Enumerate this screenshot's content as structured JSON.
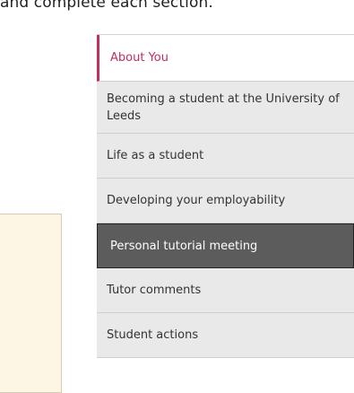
{
  "intro": {
    "text": "and complete each section."
  },
  "nav": {
    "items": [
      {
        "label": "About You"
      },
      {
        "label": "Becoming a student at the University of Leeds"
      },
      {
        "label": "Life as a student"
      },
      {
        "label": "Developing your employability"
      },
      {
        "label": "Personal tutorial meeting"
      },
      {
        "label": "Tutor comments"
      },
      {
        "label": "Student actions"
      }
    ],
    "accent_color": "#c0305a",
    "active_bg": "#5c5c5c"
  }
}
